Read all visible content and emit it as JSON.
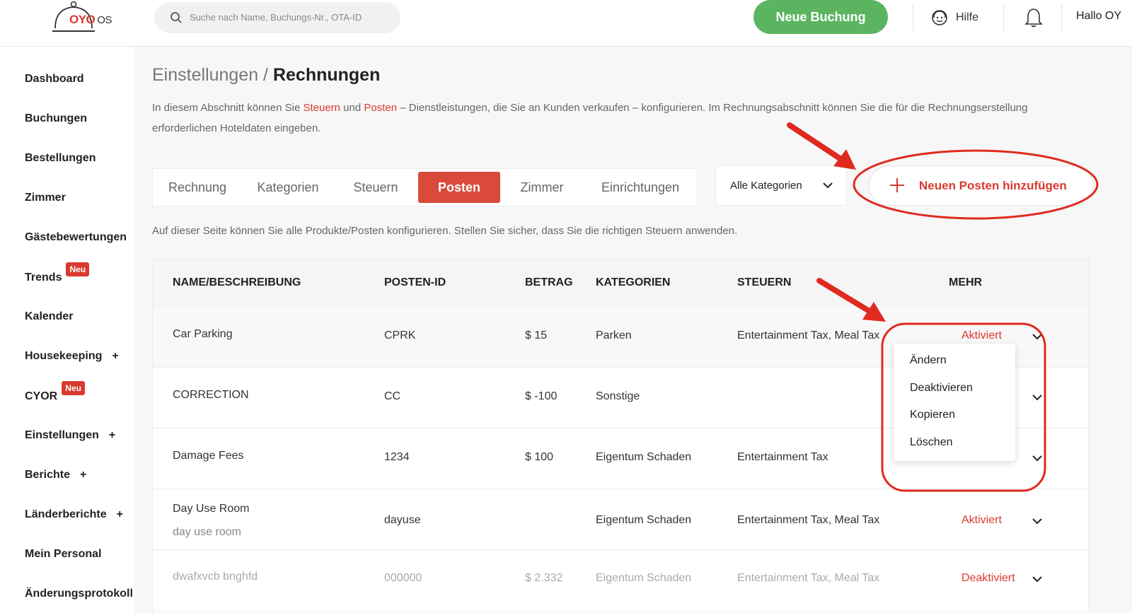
{
  "header": {
    "logo_brand": "OYO",
    "logo_suffix": "OS",
    "search_placeholder": "Suche nach Name, Buchungs-Nr., OTA-ID",
    "new_booking_label": "Neue Buchung",
    "help_label": "Hilfe",
    "greeting": "Hallo OY"
  },
  "sidebar": {
    "items": [
      {
        "label": "Dashboard"
      },
      {
        "label": "Buchungen"
      },
      {
        "label": "Bestellungen"
      },
      {
        "label": "Zimmer"
      },
      {
        "label": "Gästebewertungen"
      },
      {
        "label": "Trends",
        "badge": "Neu"
      },
      {
        "label": "Kalender"
      },
      {
        "label": "Housekeeping",
        "plus": "+"
      },
      {
        "label": "CYOR",
        "badge": "Neu"
      },
      {
        "label": "Einstellungen",
        "plus": "+"
      },
      {
        "label": "Berichte",
        "plus": "+"
      },
      {
        "label": "Länderberichte",
        "plus": "+"
      },
      {
        "label": "Mein Personal"
      },
      {
        "label": "Änderungsprotokoll"
      }
    ]
  },
  "breadcrumb": {
    "parent": "Einstellungen / ",
    "current": "Rechnungen"
  },
  "intro": {
    "part1": "In diesem Abschnitt können Sie ",
    "link1": "Steuern",
    "part2": " und ",
    "link2": "Posten",
    "part3": " – Dienstleistungen, die Sie an Kunden verkaufen – konfigurieren. Im Rechnungsabschnitt können Sie die für die Rechnungserstellung erforderlichen Hoteldaten eingeben."
  },
  "tabs": [
    {
      "label": "Rechnung"
    },
    {
      "label": "Kategorien"
    },
    {
      "label": "Steuern"
    },
    {
      "label": "Posten",
      "active": true
    },
    {
      "label": "Zimmer"
    },
    {
      "label": "Einrichtungen"
    }
  ],
  "category_select": {
    "value": "Alle Kategorien"
  },
  "add_button": {
    "label": "Neuen Posten hinzufügen"
  },
  "note": "Auf dieser Seite können Sie alle Produkte/Posten konfigurieren. Stellen Sie sicher, dass Sie die richtigen Steuern anwenden.",
  "table": {
    "headers": [
      "NAME/BESCHREIBUNG",
      "POSTEN-ID",
      "BETRAG",
      "KATEGORIEN",
      "STEUERN",
      "MEHR"
    ],
    "rows": [
      {
        "name": "Car Parking",
        "desc": "",
        "id": "CPRK",
        "amount": "$ 15",
        "category": "Parken",
        "taxes": "Entertainment Tax, Meal Tax",
        "status": "Aktiviert"
      },
      {
        "name": "CORRECTION",
        "desc": "",
        "id": "CC",
        "amount": "$ -100",
        "category": "Sonstige",
        "taxes": "",
        "status": ""
      },
      {
        "name": "Damage Fees",
        "desc": "",
        "id": "1234",
        "amount": "$ 100",
        "category": "Eigentum Schaden",
        "taxes": "Entertainment Tax",
        "status": ""
      },
      {
        "name": "Day Use Room",
        "desc": "day use room",
        "id": "dayuse",
        "amount": "",
        "category": "Eigentum Schaden",
        "taxes": "Entertainment Tax, Meal Tax",
        "status": "Aktiviert"
      },
      {
        "name": "dwafxvcb bnghfd",
        "desc": "",
        "id": "000000",
        "amount": "$ 2.332",
        "category": "Eigentum Schaden",
        "taxes": "Entertainment Tax, Meal Tax",
        "status": "Deaktiviert"
      }
    ]
  },
  "row_menu": {
    "items": [
      "Ändern",
      "Deaktivieren",
      "Kopieren",
      "Löschen"
    ]
  },
  "colors": {
    "brand_red": "#d93a2f",
    "green": "#5bb560",
    "annotation_red": "#e02a1f"
  }
}
